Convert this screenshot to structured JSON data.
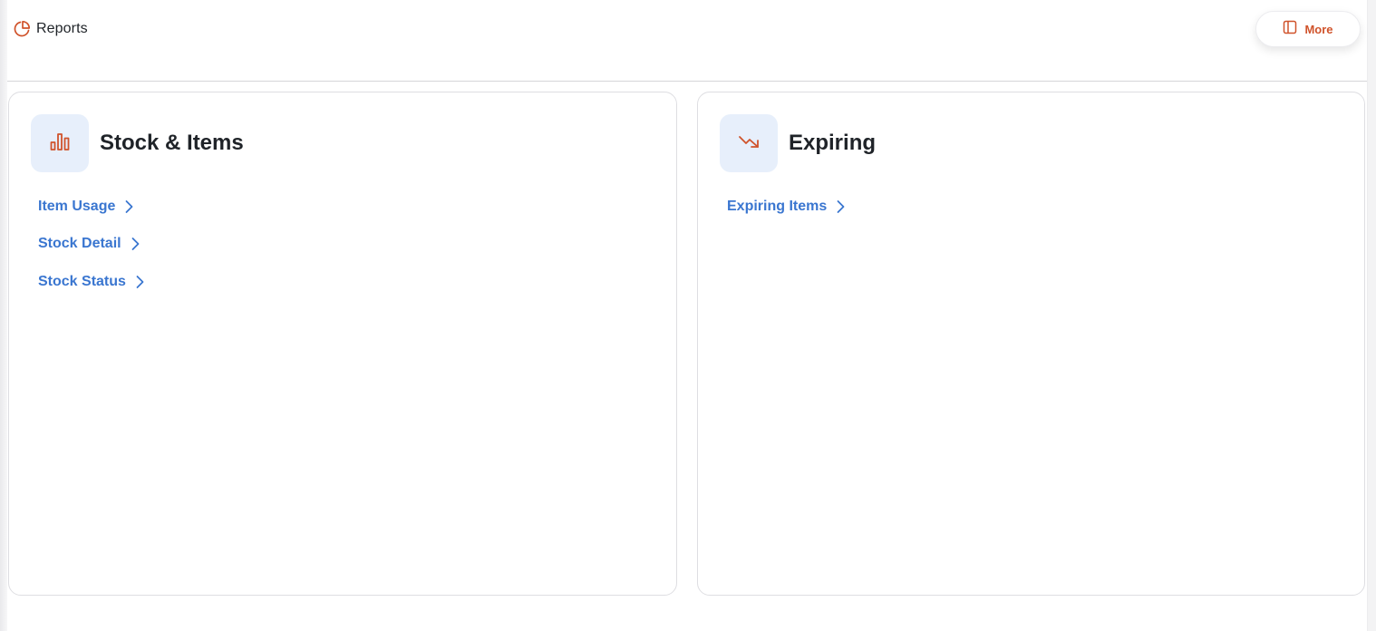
{
  "header": {
    "title": "Reports",
    "more_label": "More"
  },
  "icons": {
    "reports": "pie-chart-icon",
    "more": "panel-icon",
    "stock_items": "bar-chart-icon",
    "expiring": "trending-down-icon",
    "link_arrow": "chevron-right-icon"
  },
  "colors": {
    "accent": "#d0532b",
    "link": "#3a76d0",
    "icon_tile": "#e7effb",
    "border": "#dedee2"
  },
  "cards": [
    {
      "title": "Stock & Items",
      "links": [
        {
          "label": "Item Usage"
        },
        {
          "label": "Stock Detail"
        },
        {
          "label": "Stock Status"
        }
      ]
    },
    {
      "title": "Expiring",
      "links": [
        {
          "label": "Expiring Items"
        }
      ]
    }
  ]
}
